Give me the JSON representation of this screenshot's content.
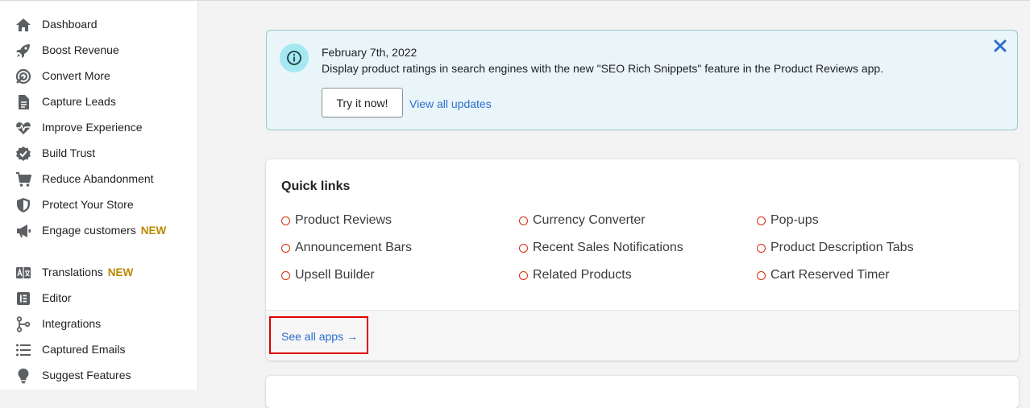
{
  "sidebar": {
    "items": [
      {
        "label": "Dashboard",
        "icon": "home-icon",
        "badge": ""
      },
      {
        "label": "Boost Revenue",
        "icon": "rocket-icon",
        "badge": ""
      },
      {
        "label": "Convert More",
        "icon": "target-icon",
        "badge": ""
      },
      {
        "label": "Capture Leads",
        "icon": "document-icon",
        "badge": ""
      },
      {
        "label": "Improve Experience",
        "icon": "heartbeat-icon",
        "badge": ""
      },
      {
        "label": "Build Trust",
        "icon": "badge-check-icon",
        "badge": ""
      },
      {
        "label": "Reduce Abandonment",
        "icon": "cart-icon",
        "badge": ""
      },
      {
        "label": "Protect Your Store",
        "icon": "shield-icon",
        "badge": ""
      },
      {
        "label": "Engage customers",
        "icon": "megaphone-icon",
        "badge": "NEW"
      },
      {
        "label": "Translations",
        "icon": "translate-icon",
        "badge": "NEW"
      },
      {
        "label": "Editor",
        "icon": "editor-icon",
        "badge": ""
      },
      {
        "label": "Integrations",
        "icon": "integrations-icon",
        "badge": ""
      },
      {
        "label": "Captured Emails",
        "icon": "list-icon",
        "badge": ""
      },
      {
        "label": "Suggest Features",
        "icon": "lightbulb-icon",
        "badge": ""
      }
    ]
  },
  "banner": {
    "date": "February 7th, 2022",
    "message": "Display product ratings in search engines with the new \"SEO Rich Snippets\" feature in the Product Reviews app.",
    "primary_button": "Try it now!",
    "link": "View all updates"
  },
  "quick_links": {
    "title": "Quick links",
    "items": [
      "Product Reviews",
      "Currency Converter",
      "Pop-ups",
      "Announcement Bars",
      "Recent Sales Notifications",
      "Product Description Tabs",
      "Upsell Builder",
      "Related Products",
      "Cart Reserved Timer"
    ],
    "see_all": "See all apps →"
  },
  "colors": {
    "accent_link": "#2c6ecb",
    "new_badge": "#b98900",
    "banner_bg": "#eaf5fa",
    "quick_link_dot": "#d72c0d",
    "highlight": "#e00000"
  }
}
